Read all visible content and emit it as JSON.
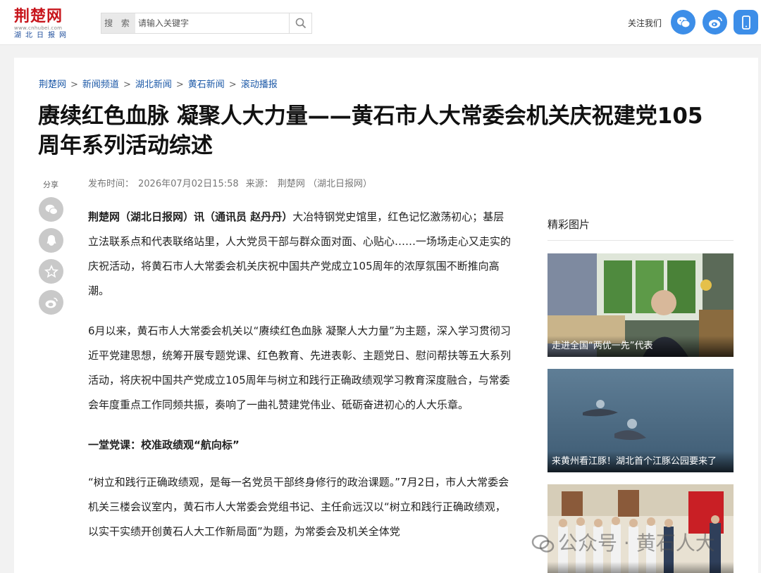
{
  "header": {
    "logo": {
      "main": "荆楚网",
      "url": "www.cnhubei.com",
      "sub": "湖北日报网"
    },
    "search": {
      "label": "搜 索",
      "placeholder": "请输入关键字"
    },
    "follow_label": "关注我们",
    "social_icons": [
      "wechat-icon",
      "weibo-icon",
      "mobile-icon"
    ]
  },
  "breadcrumb": [
    "荆楚网",
    "新闻频道",
    "湖北新闻",
    "黄石新闻",
    "滚动播报"
  ],
  "article": {
    "title": "赓续红色血脉 凝聚人大力量——黄石市人大常委会机关庆祝建党105周年系列活动综述",
    "published_label": "发布时间：",
    "published": "2026年07月02日15:58",
    "source_label": "来源：",
    "source": "荆楚网 （湖北日报网）",
    "lead_bold": "荆楚网（湖北日报网）讯（通讯员 赵丹丹）",
    "p1": "大冶特钢党史馆里，红色记忆激荡初心；基层立法联系点和代表联络站里，人大党员干部与群众面对面、心贴心……一场场走心又走实的庆祝活动，将黄石市人大常委会机关庆祝中国共产党成立105周年的浓厚氛围不断推向高潮。",
    "p2": "6月以来，黄石市人大常委会机关以“赓续红色血脉 凝聚人大力量”为主题，深入学习贯彻习近平党建思想，统筹开展专题党课、红色教育、先进表彰、主题党日、慰问帮扶等五大系列活动，将庆祝中国共产党成立105周年与树立和践行正确政绩观学习教育深度融合，与常委会年度重点工作同频共振，奏响了一曲礼赞建党伟业、砥砺奋进初心的人大乐章。",
    "subhead": "一堂党课：校准政绩观“航向标”",
    "p3": "“树立和践行正确政绩观，是每一名党员干部终身修行的政治课题。”7月2日，市人大常委会机关三楼会议室内，黄石市人大常委会党组书记、主任俞远汉以“树立和践行正确政绩观，以实干实绩开创黄石人大工作新局面”为题，为常委会及机关全体党"
  },
  "share": {
    "label": "分享",
    "icons": [
      "wechat-icon",
      "qq-icon",
      "qzone-icon",
      "weibo-icon"
    ]
  },
  "sidebar": {
    "title": "精彩图片",
    "items": [
      {
        "caption": "走进全国“两优一先”代表"
      },
      {
        "caption": "来黄州看江豚！湖北首个江豚公园要来了"
      },
      {
        "caption": ""
      }
    ]
  },
  "watermark": "公众号 · 黄石人大"
}
